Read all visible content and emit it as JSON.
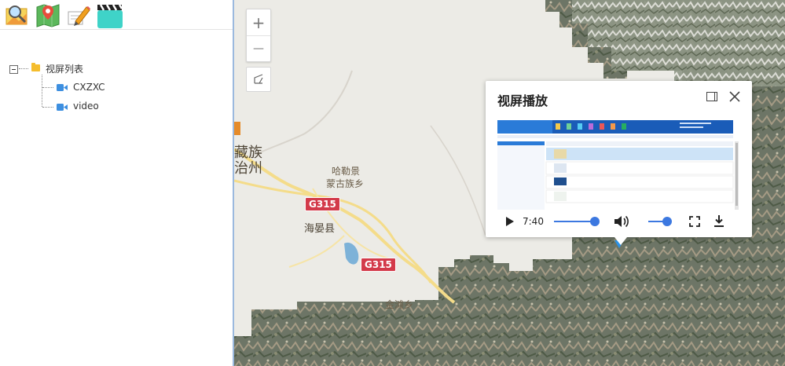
{
  "tree": {
    "root_label": "视屏列表",
    "children": [
      {
        "label": "CXZXC"
      },
      {
        "label": "video"
      }
    ]
  },
  "toolbar": {
    "icons": [
      "search-map-icon",
      "map-pin-icon",
      "edit-pencil-icon",
      "clapperboard-icon"
    ]
  },
  "map": {
    "labels": {
      "county": "海晏县",
      "township1_line1": "哈勒景",
      "township1_line2": "蒙古族乡",
      "township2": "金滩乡",
      "prefecture_line1": "藏族",
      "prefecture_line2": "治州"
    },
    "roads": [
      "G315",
      "G315"
    ],
    "controls": {
      "zoom_in": "+",
      "zoom_out": "—"
    }
  },
  "popup": {
    "title": "视屏播放",
    "video": {
      "current_time": "7:40",
      "progress": 1.0,
      "volume": 1.0
    }
  }
}
